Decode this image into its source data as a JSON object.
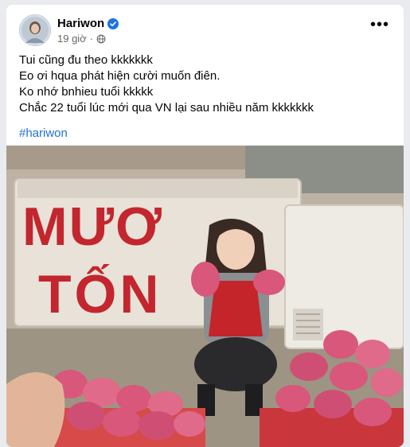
{
  "post": {
    "author": "Hariwon",
    "timestamp": "19 giờ",
    "lines": [
      "Tui cũng đu theo kkkkkkk",
      "Eo ơi hqua phát hiện cười muốn điên.",
      "",
      "Ko nhớ bnhieu tuổi kkkkk",
      "Chắc 22 tuổi lúc mới qua VN lại sau nhiều năm kkkkkkk"
    ],
    "hashtag": "#hariwon",
    "photo": {
      "sign_text_line1": "MƯƠ",
      "sign_text_line2": "TỐN",
      "icons": [
        "verified-badge-icon",
        "globe-icon",
        "more-options-icon"
      ]
    }
  },
  "colors": {
    "author_text": "#050505",
    "meta_text": "#65676b",
    "hashtag": "#216fdb",
    "verified": "#1b74e4",
    "sign_red": "#c3262e",
    "dragonfruit": "#d8577a"
  }
}
